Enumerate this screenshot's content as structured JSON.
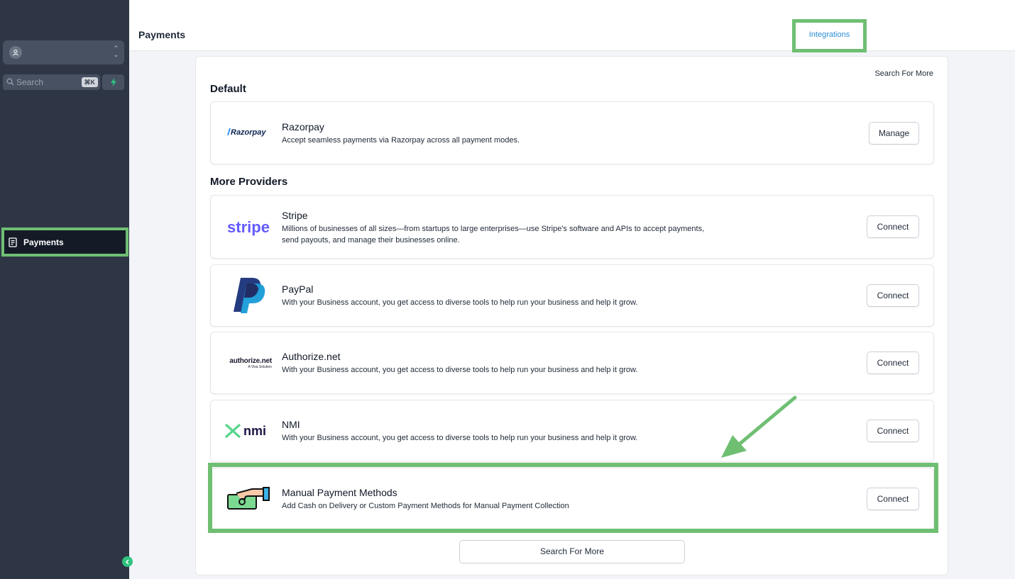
{
  "sidebar": {
    "search_placeholder": "Search",
    "search_shortcut": "⌘K",
    "nav_payments": "Payments"
  },
  "header": {
    "title": "Payments",
    "tab_integrations": "Integrations"
  },
  "main": {
    "search_more_top": "Search For More",
    "default_section": "Default",
    "more_section": "More Providers",
    "search_more_button": "Search For More"
  },
  "providers": {
    "razorpay": {
      "logo": "Razorpay",
      "name": "Razorpay",
      "desc": "Accept seamless payments via Razorpay across all payment modes.",
      "button": "Manage"
    },
    "stripe": {
      "logo": "stripe",
      "name": "Stripe",
      "desc": "Millions of businesses of all sizes—from startups to large enterprises—use Stripe's software and APIs to accept payments, send payouts, and manage their businesses online.",
      "button": "Connect"
    },
    "paypal": {
      "name": "PayPal",
      "desc": "With your Business account, you get access to diverse tools to help run your business and help it grow.",
      "button": "Connect"
    },
    "authorize": {
      "logo": "authorize.net",
      "logo_sub": "A Visa Solution",
      "name": "Authorize.net",
      "desc": "With your Business account, you get access to diverse tools to help run your business and help it grow.",
      "button": "Connect"
    },
    "nmi": {
      "logo": "nmi",
      "name": "NMI",
      "desc": "With your Business account, you get access to diverse tools to help run your business and help it grow.",
      "button": "Connect"
    },
    "manual": {
      "name": "Manual Payment Methods",
      "desc": "Add Cash on Delivery or Custom Payment Methods for Manual Payment Collection",
      "button": "Connect"
    }
  },
  "colors": {
    "sidebar_bg": "#2e3645",
    "highlight": "#6fbf73",
    "accent_blue": "#2b8fd6",
    "stripe_purple": "#635bff"
  }
}
